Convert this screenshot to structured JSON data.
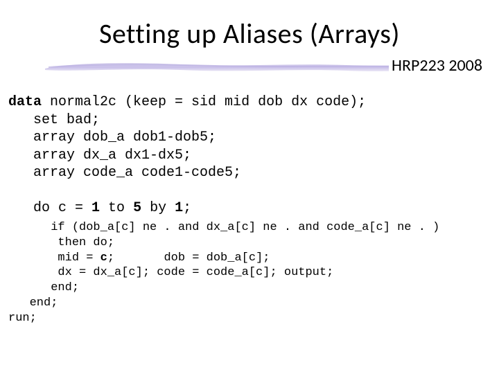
{
  "title": "Setting up Aliases (Arrays)",
  "course_tag": "HRP223 2008",
  "code": {
    "block1": {
      "l1a": "data",
      "l1b": " normal2c (keep = sid mid dob dx code);",
      "l2": "   set bad;",
      "l3": "   array dob_a dob1-dob5;",
      "l4": "   array dx_a dx1-dx5;",
      "l5": "   array code_a code1-code5;"
    },
    "block2": {
      "l1a": "   do c = ",
      "l1b": "1",
      "l1c": " to ",
      "l1d": "5",
      "l1e": " by ",
      "l1f": "1",
      "l1g": ";"
    },
    "block3": {
      "l1": "      if (dob_a[c] ne . and dx_a[c] ne . and code_a[c] ne . )",
      "l2": "       then do;",
      "l3a": "       mid = ",
      "l3b": "c",
      "l3c": ";       dob = dob_a[c];",
      "l4": "       dx = dx_a[c]; code = code_a[c]; output;",
      "l5": "      end;",
      "l6": "   end;",
      "l7": "run;"
    }
  }
}
